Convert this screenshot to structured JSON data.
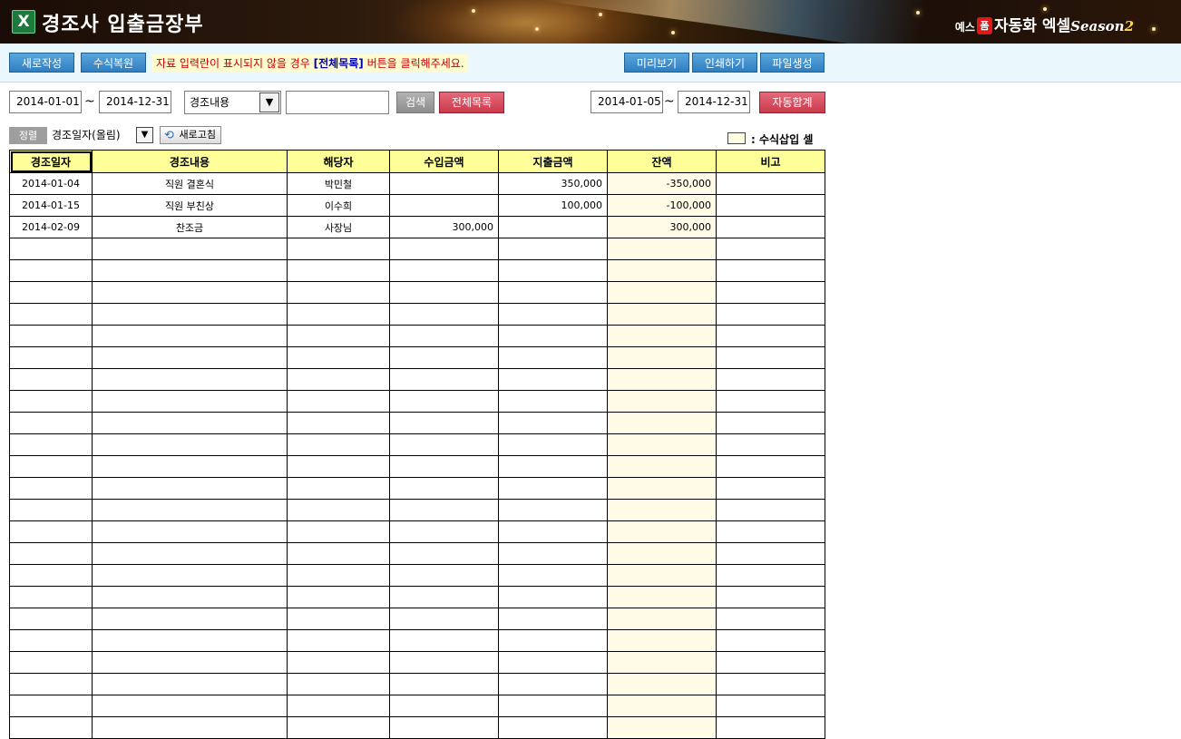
{
  "header": {
    "app_icon": "X",
    "title": "경조사 입출금장부",
    "brand_prefix": "예스",
    "brand_badge": "폼",
    "brand_name": "자동화 엑셀",
    "brand_season": "Season",
    "brand_season_num": "2"
  },
  "toolbar": {
    "new_label": "새로작성",
    "restore_label": "수식복원",
    "notice_pre": "자료 입력란이 표시되지  않을 경우 ",
    "notice_hl": "[전체목록]",
    "notice_post": " 버튼을 클릭해주세요.",
    "preview_label": "미리보기",
    "print_label": "인쇄하기",
    "file_label": "파일생성"
  },
  "filter": {
    "date_from": "2014-01-01",
    "date_to": "2014-12-31",
    "tilde": "~",
    "field_select": "경조내용",
    "search_value": "",
    "search_label": "검색",
    "all_list_label": "전체목록",
    "sum_from": "2014-01-05",
    "sum_to": "2014-12-31",
    "auto_sum_label": "자동합계"
  },
  "sort": {
    "label": "정렬",
    "value": "경조일자(올림)",
    "refresh_label": "새로고침"
  },
  "legend": {
    "text": ": 수식삽입 셀"
  },
  "table": {
    "headers": [
      "경조일자",
      "경조내용",
      "해당자",
      "수입금액",
      "지출금액",
      "잔액",
      "비고"
    ],
    "rows": [
      [
        "2014-01-04",
        "직원 결혼식",
        "박민철",
        "",
        "350,000",
        "-350,000",
        ""
      ],
      [
        "2014-01-15",
        "직원 부친상",
        "이수희",
        "",
        "100,000",
        "-100,000",
        ""
      ],
      [
        "2014-02-09",
        "찬조금",
        "사장님",
        "300,000",
        "",
        "300,000",
        ""
      ]
    ]
  },
  "colors": {
    "header_yellow": "#ffff99",
    "balance_cell": "#fffbe6",
    "blue_button": "#2f7ec0",
    "red_button": "#c93a4c",
    "toolbar_bg": "#eaf8fd"
  }
}
